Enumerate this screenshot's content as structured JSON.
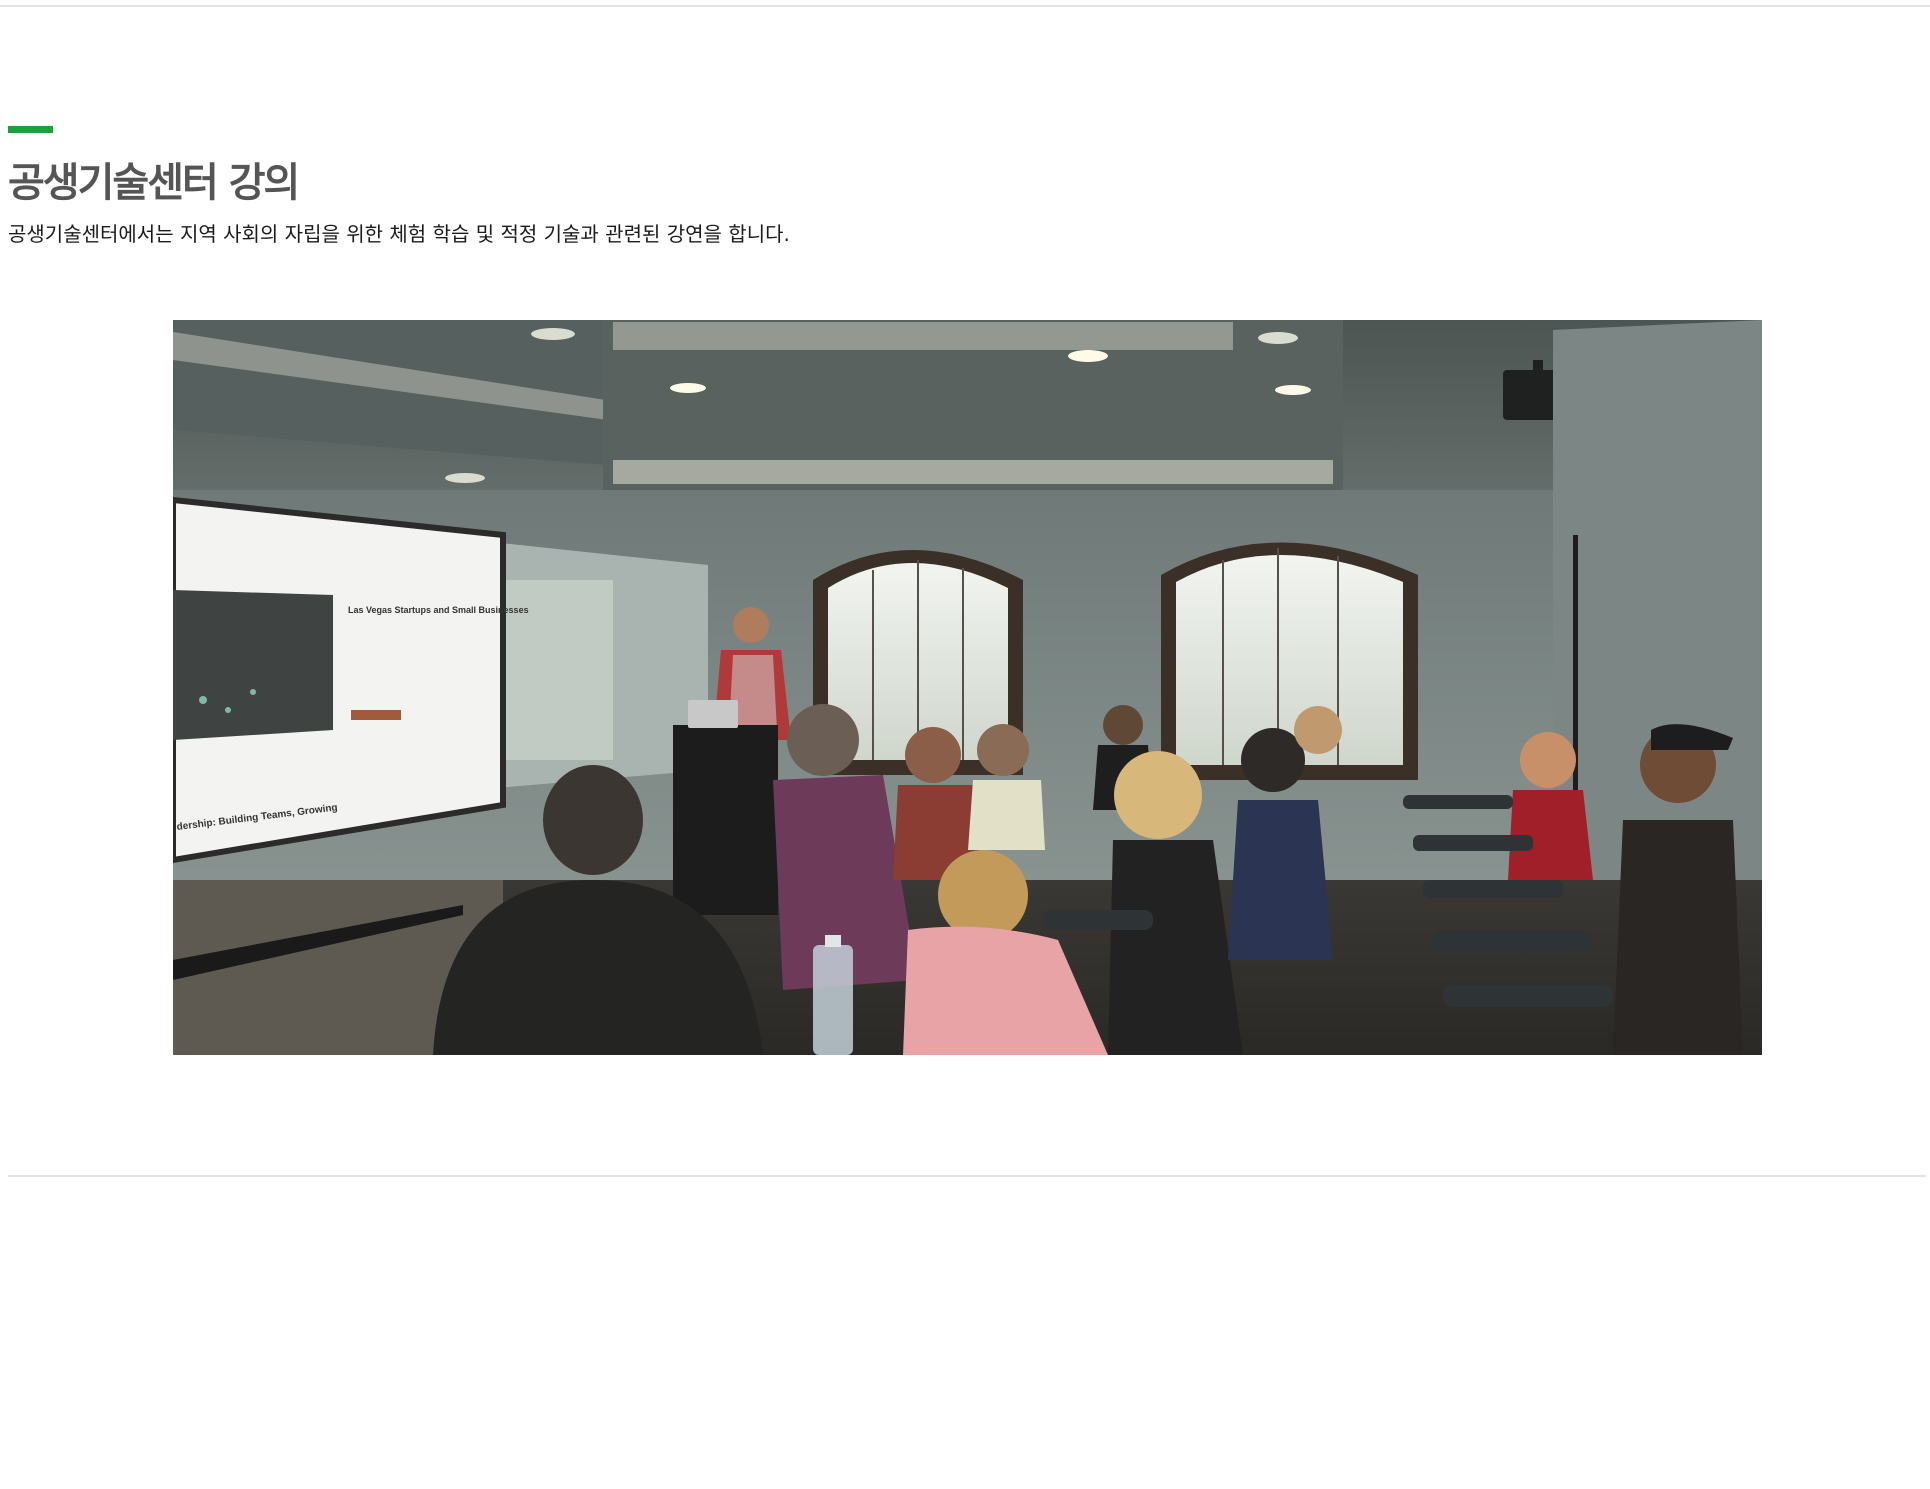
{
  "section": {
    "title": "공생기술센터 강의",
    "description": "공생기술센터에서는 지역 사회의 자립을 위한 체험 학습 및 적정 기술과 관련된 강연을 합니다."
  },
  "screen": {
    "heading": "Las Vegas Startups and Small Businesses",
    "footer_text": "dership: Building Teams, Growing"
  },
  "colors": {
    "accent": "#1aa33a",
    "title": "#555555",
    "rule": "#e3e3e3"
  }
}
